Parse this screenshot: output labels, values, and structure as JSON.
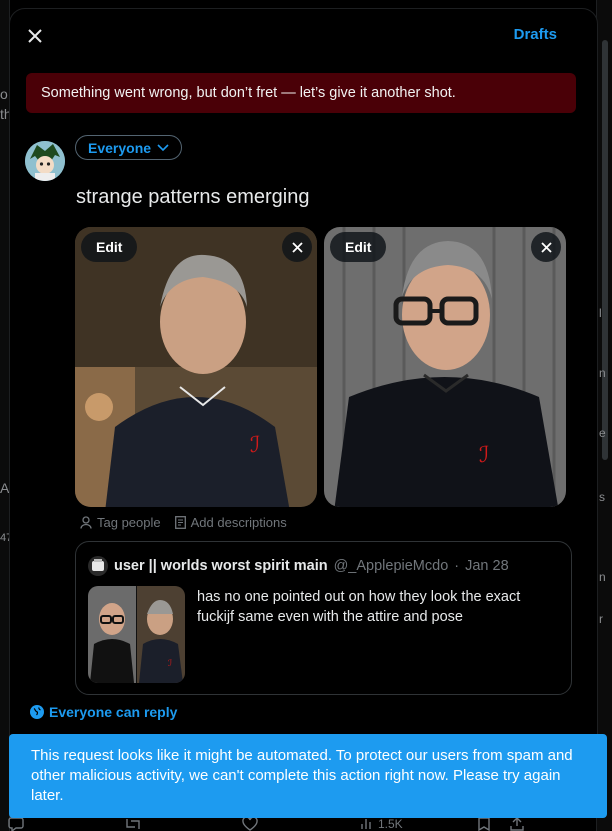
{
  "background": {
    "left_fragments": [
      "o",
      "th",
      "A",
      "47"
    ],
    "right_fragments": [
      "l",
      "n",
      "e",
      "s",
      "n",
      "r"
    ],
    "actions": {
      "views": "1.5K"
    }
  },
  "topbar": {
    "close_icon": "close-icon",
    "drafts_label": "Drafts"
  },
  "error": {
    "message": "Something went wrong, but don’t fret — let’s give it another shot."
  },
  "composer": {
    "audience_label": "Everyone",
    "text": "strange patterns emerging",
    "media": [
      {
        "edit_label": "Edit",
        "description": "man in dark zip-up sweater with red monogram"
      },
      {
        "edit_label": "Edit",
        "description": "man with glasses in dark shirt with red monogram"
      }
    ],
    "tools": {
      "tag_people": "Tag people",
      "add_descriptions": "Add descriptions"
    }
  },
  "quote": {
    "name": "user || worlds worst spirit main",
    "handle": "@_ApplepieMcdo",
    "separator": "·",
    "date": "Jan 28",
    "text": "has no one pointed out on how they look the exact fuckijf same even with the attire and pose"
  },
  "reply_setting": {
    "label": "Everyone can reply"
  },
  "toast": {
    "message": "This request looks like it might be automated. To protect our users from spam and other malicious activity, we can't complete this action right now. Please try again later."
  },
  "colors": {
    "accent": "#1d9bf0",
    "error_bg": "#4a0007",
    "toast_bg": "#1d9bf0"
  }
}
